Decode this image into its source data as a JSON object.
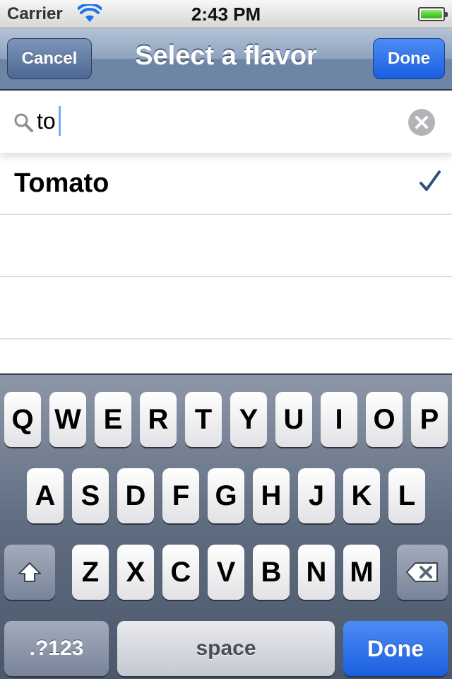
{
  "status_bar": {
    "carrier": "Carrier",
    "time": "2:43 PM",
    "wifi_icon": "wifi-icon",
    "battery_icon": "battery-icon",
    "battery_level": 1.0,
    "battery_color": "#3cc11b"
  },
  "nav_bar": {
    "title": "Select a flavor",
    "cancel_label": "Cancel",
    "done_label": "Done",
    "accent_color": "#1a5fe0"
  },
  "search": {
    "value": "to",
    "search_icon": "search-icon",
    "clear_icon": "clear-icon"
  },
  "results": [
    {
      "label": "Tomato",
      "checked": true
    }
  ],
  "keyboard": {
    "row1": [
      "Q",
      "W",
      "E",
      "R",
      "T",
      "Y",
      "U",
      "I",
      "O",
      "P"
    ],
    "row2": [
      "A",
      "S",
      "D",
      "F",
      "G",
      "H",
      "J",
      "K",
      "L"
    ],
    "row3": [
      "Z",
      "X",
      "C",
      "V",
      "B",
      "N",
      "M"
    ],
    "shift_icon": "shift-icon",
    "delete_icon": "delete-icon",
    "numbers_label": ".?123",
    "space_label": "space",
    "return_label": "Done"
  }
}
